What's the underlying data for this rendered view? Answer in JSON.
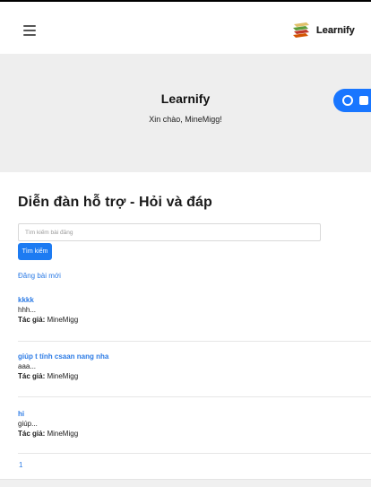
{
  "navbar": {
    "menu_icon": "hamburger-icon",
    "brand_name": "Learnify",
    "brand_icon": "books-icon"
  },
  "hero": {
    "title": "Learnify",
    "greeting": "Xin chào, MineMigg!",
    "action_icons": [
      "refresh-icon",
      "camera-icon"
    ],
    "accent_color": "#1976ff"
  },
  "forum": {
    "title": "Diễn đàn hỗ trợ - Hỏi và đáp",
    "search_placeholder": "Tìm kiếm bài đăng",
    "search_button": "Tìm kiếm",
    "new_post_link": "Đăng bài mới",
    "author_label": "Tác giả:",
    "posts": [
      {
        "title": "kkkk",
        "excerpt": "hhh...",
        "author": "MineMigg"
      },
      {
        "title": "giúp t tính csaan nang nha",
        "excerpt": "aaa...",
        "author": "MineMigg"
      },
      {
        "title": "hi",
        "excerpt": "giúp...",
        "author": "MineMigg"
      }
    ],
    "pagination": [
      "1"
    ]
  },
  "colors": {
    "link": "#2c7be5",
    "button": "#1d7bf2",
    "hero_bg": "#eeeeee"
  }
}
